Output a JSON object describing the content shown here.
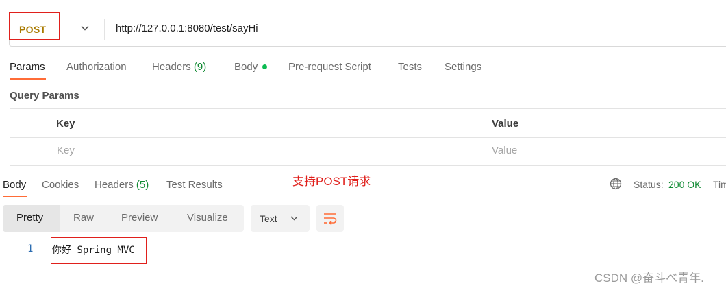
{
  "request": {
    "method": "POST",
    "url": "http://127.0.0.1:8080/test/sayHi"
  },
  "request_tabs": [
    {
      "label": "Params",
      "active": true
    },
    {
      "label": "Authorization"
    },
    {
      "label": "Headers",
      "count": "(9)"
    },
    {
      "label": "Body",
      "dot": true
    },
    {
      "label": "Pre-request Script"
    },
    {
      "label": "Tests"
    },
    {
      "label": "Settings"
    }
  ],
  "query_params": {
    "title": "Query Params",
    "columns": [
      "Key",
      "Value"
    ],
    "placeholders": [
      "Key",
      "Value"
    ]
  },
  "response": {
    "tabs": [
      {
        "label": "Body",
        "active": true
      },
      {
        "label": "Cookies"
      },
      {
        "label": "Headers",
        "count": "(5)"
      },
      {
        "label": "Test Results"
      }
    ],
    "annotation": "支持POST请求",
    "status_label": "Status:",
    "status_value": "200 OK",
    "time_label": "Tim",
    "view_modes": [
      "Pretty",
      "Raw",
      "Preview",
      "Visualize"
    ],
    "active_view": "Pretty",
    "format": "Text",
    "body_lines": [
      {
        "number": "1",
        "text": "你好 Spring MVC"
      }
    ]
  },
  "watermark": "CSDN @奋斗べ青年.",
  "colors": {
    "method": "#a97a00",
    "accent": "#ff6c37",
    "success": "#0f8a32",
    "annotation": "#e0201c",
    "body_dot": "#0cbb52"
  },
  "icons": [
    "chevron-down-icon",
    "globe-icon",
    "wrap-lines-icon"
  ]
}
